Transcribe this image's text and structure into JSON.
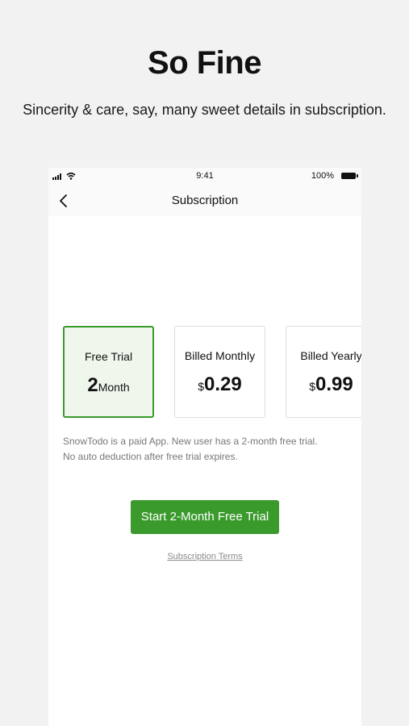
{
  "headline": "So Fine",
  "subheadline": "Sincerity & care, say, many sweet details in subscription.",
  "status_bar": {
    "time": "9:41",
    "battery": "100%"
  },
  "nav": {
    "title": "Subscription",
    "back_icon": "chevron-left-icon"
  },
  "plans": [
    {
      "name": "Free Trial",
      "amount": "2",
      "unit": "Month",
      "selected": true
    },
    {
      "name": "Billed Monthly",
      "currency": "$",
      "amount": "0.29",
      "selected": false
    },
    {
      "name": "Billed Yearly",
      "currency": "$",
      "amount": "0.99",
      "selected": false
    }
  ],
  "note": {
    "line1": "SnowTodo is a paid App. New user has a 2-month free trial.",
    "line2": "No auto deduction after free trial expires."
  },
  "cta_label": "Start 2-Month Free Trial",
  "terms_label": "Subscription Terms",
  "colors": {
    "accent": "#3a9a2c",
    "selected_bg": "#eff7ec",
    "page_bg": "#f2f2f2"
  }
}
